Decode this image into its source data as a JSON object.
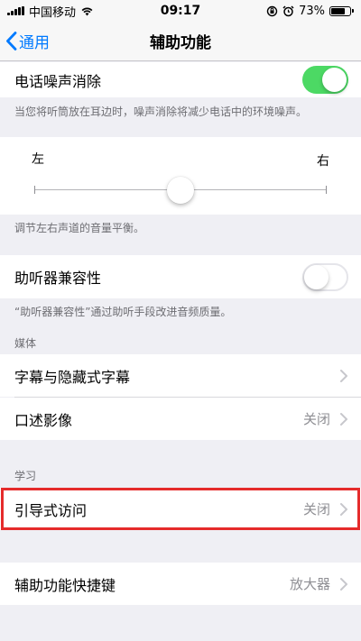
{
  "status_bar": {
    "carrier": "中国移动",
    "time": "09:17",
    "battery": "73%",
    "battery_level": 0.73
  },
  "nav": {
    "back_label": "通用",
    "title": "辅助功能"
  },
  "phone_noise": {
    "label": "电话噪声消除",
    "enabled": true,
    "footer": "当您将听筒放在耳边时，噪声消除将减少电话中的环境噪声。"
  },
  "balance": {
    "left_label": "左",
    "right_label": "右",
    "value": 0.5,
    "footer": "调节左右声道的音量平衡。"
  },
  "hearing_aid": {
    "label": "助听器兼容性",
    "enabled": false,
    "footer": "“助听器兼容性”通过助听手段改进音频质量。"
  },
  "media": {
    "header": "媒体",
    "items": [
      {
        "label": "字幕与隐藏式字幕",
        "value": ""
      },
      {
        "label": "口述影像",
        "value": "关闭"
      }
    ]
  },
  "learning": {
    "header": "学习",
    "items": [
      {
        "label": "引导式访问",
        "value": "关闭"
      }
    ]
  },
  "shortcut": {
    "label": "辅助功能快捷键",
    "value": "放大器"
  },
  "colors": {
    "accent": "#007aff",
    "toggle_on": "#4cd964",
    "highlight": "#e52b2b"
  }
}
